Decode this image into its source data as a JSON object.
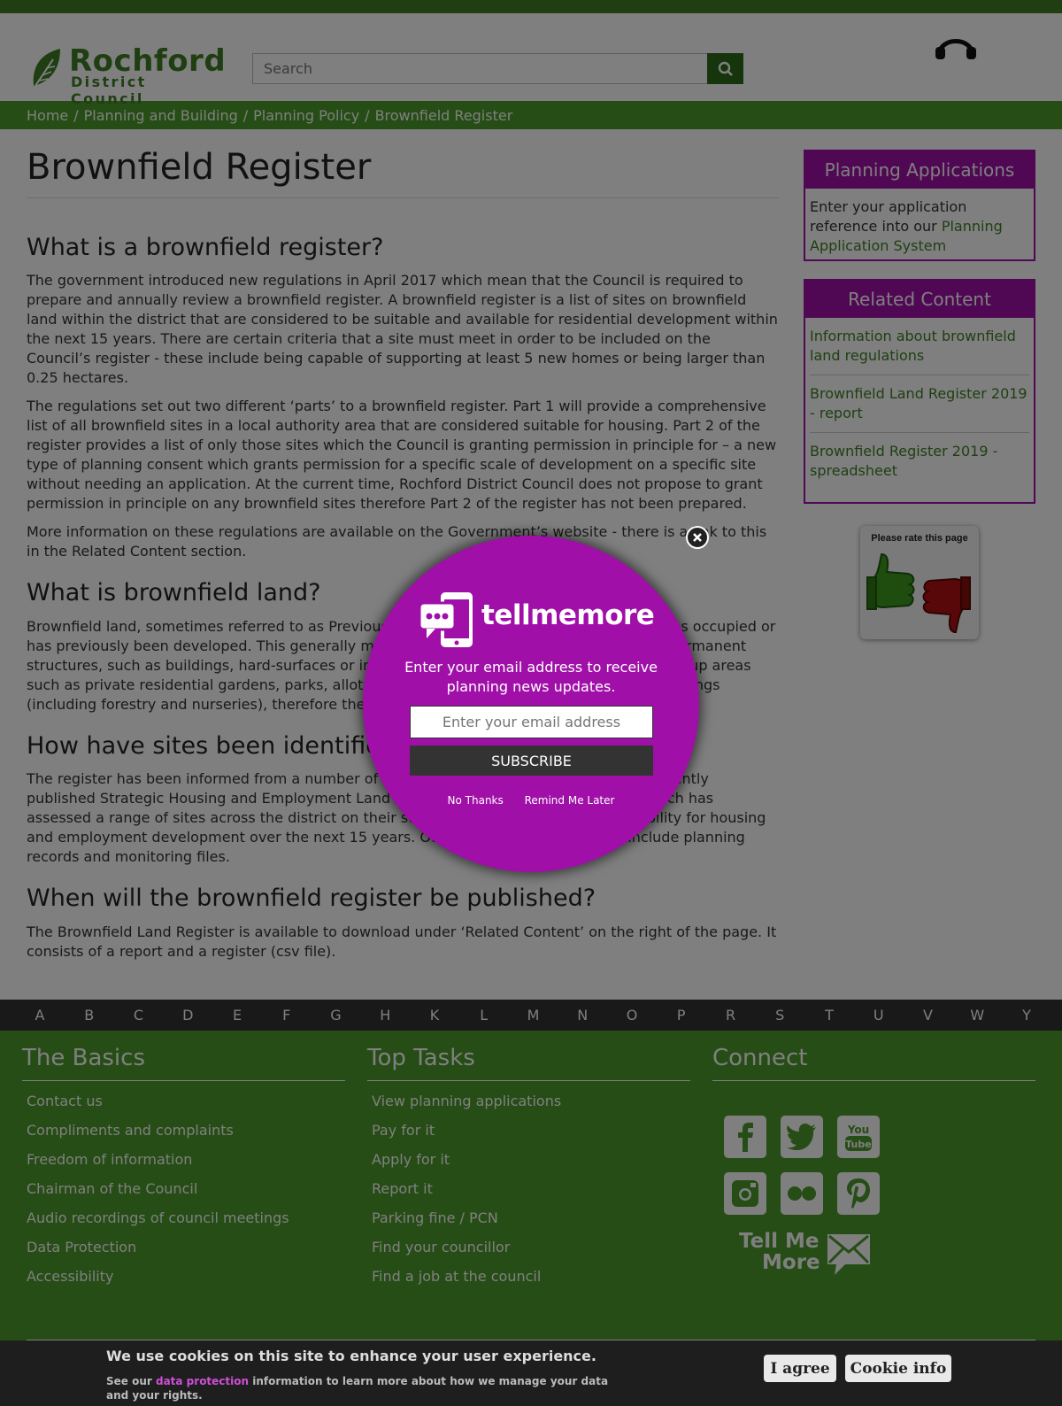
{
  "header": {
    "logo_name": "Rochford",
    "logo_sub": "District Council",
    "search_placeholder": "Search"
  },
  "breadcrumb": [
    "Home",
    "Planning and Building",
    "Planning Policy",
    "Brownfield Register"
  ],
  "main": {
    "title": "Brownfield Register",
    "sections": [
      {
        "heading": "What is a brownfield register?",
        "paragraphs": [
          "The government introduced new regulations in April 2017 which mean that the Council is required to prepare and annually review a brownfield register. A brownfield register is a list of sites on brownfield land within the district that are considered to be suitable and available for residential development within the next 15 years. There are certain criteria that a site must meet in order to be included on the Council’s register - these include being capable of supporting at least 5 new homes or being larger than 0.25 hectares.",
          "The regulations set out two different ‘parts’ to a brownfield register. Part 1 will provide a comprehensive list of all brownfield sites in a local authority area that are considered suitable for housing. Part 2 of the register provides a list of only those sites which the Council is granting permission in principle for – a new type of planning consent which grants permission for a specific scale of development on a specific site without needing an application. At the current time, Rochford District Council does not propose to grant permission in principle on any brownfield sites therefore Part 2 of the register has not been prepared.",
          "More information on these regulations are available on the Government’s website - there is a link to this in the Related Content section."
        ]
      },
      {
        "heading": "What is brownfield land?",
        "paragraphs": [
          "Brownfield land, sometimes referred to as Previously Developed Land, is land which is or was occupied or has previously been developed. This generally means that the land has been occupied by permanent structures, such as buildings, hard-surfaces or infrastructure. It does not include land in built-up areas such as private residential gardens, parks, allotments, mineral extraction or agricultural buildings (including forestry and nurseries), therefore these sites will not be included on the register."
        ]
      },
      {
        "heading": "How have sites been identified?",
        "paragraphs": [
          "The register has been informed from a number of sources, including the Council’s most recently published Strategic Housing and Employment Land Availability Assessment (SHELAA), which has assessed a range of sites across the district on their suitability, availability and achievability for housing and employment development over the next 15 years. Other sources of information include planning records and monitoring files."
        ]
      },
      {
        "heading": "When will the brownfield register be published?",
        "paragraphs": [
          "The Brownfield Land Register is available to download under ‘Related Content’ on the right of the page. It consists of a report and a register (csv file)."
        ]
      }
    ]
  },
  "sidebar": {
    "planning": {
      "title": "Planning Applications",
      "text": "Enter your application reference into our ",
      "link": "Planning Application System"
    },
    "related": {
      "title": "Related Content",
      "items": [
        "Information about brownfield land regulations",
        "Brownfield Land Register 2019 - report",
        "Brownfield Register 2019 - spreadsheet"
      ]
    },
    "rate_title": "Please rate this page"
  },
  "alphabet": [
    "A",
    "B",
    "C",
    "D",
    "E",
    "F",
    "G",
    "H",
    "K",
    "L",
    "M",
    "N",
    "O",
    "P",
    "R",
    "S",
    "T",
    "U",
    "V",
    "W",
    "Y"
  ],
  "footer": {
    "basics": {
      "title": "The Basics",
      "items": [
        "Contact us",
        "Compliments and complaints",
        "Freedom of information",
        "Chairman of the Council",
        "Audio recordings of council meetings",
        "Data Protection",
        "Accessibility"
      ]
    },
    "tasks": {
      "title": "Top Tasks",
      "items": [
        "View planning applications",
        "Pay for it",
        "Apply for it",
        "Report it",
        "Parking fine / PCN",
        "Find your councillor",
        "Find a job at the council"
      ]
    },
    "connect": {
      "title": "Connect",
      "tmm_line1": "Tell Me",
      "tmm_line2": "More"
    }
  },
  "popup": {
    "brand": "tellmemore",
    "message": "Enter your email address to receive planning news updates.",
    "email_placeholder": "Enter your email address",
    "subscribe": "SUBSCRIBE",
    "no_thanks": "No Thanks",
    "remind": "Remind Me Later"
  },
  "cookie": {
    "title": "We use cookies on this site to enhance your user experience.",
    "text_before": "See our ",
    "link": "data protection",
    "text_after": " information to learn more about how we manage your data and your rights.",
    "agree": "I agree",
    "info": "Cookie info"
  },
  "colors": {
    "brand_green": "#4c9a2a",
    "dark_green": "#3f7f25",
    "purple": "#a010a8"
  }
}
